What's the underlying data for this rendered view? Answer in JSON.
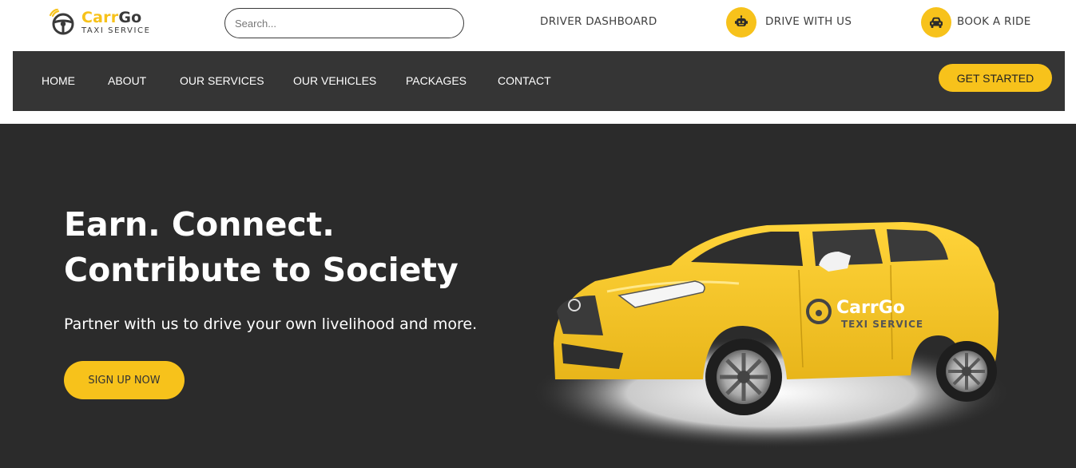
{
  "brand": {
    "name_part1": "Carr",
    "name_part2": "Go",
    "tagline": "TAXI SERVICE",
    "accent_color": "#f7c21b"
  },
  "search": {
    "placeholder": "Search..."
  },
  "top_links": {
    "driver_dashboard": "DRIVER DASHBOARD",
    "drive_with_us": "DRIVE WITH US",
    "drive_with_us_icon": "robot-icon",
    "book_a_ride": "BOOK A RIDE",
    "book_a_ride_icon": "car-icon"
  },
  "nav": {
    "items": [
      {
        "label": "HOME"
      },
      {
        "label": "ABOUT"
      },
      {
        "label": "OUR SERVICES"
      },
      {
        "label": "OUR VEHICLES"
      },
      {
        "label": "PACKAGES"
      },
      {
        "label": "CONTACT"
      }
    ],
    "cta_label": "GET STARTED",
    "background_color": "#353535"
  },
  "hero": {
    "title": "Earn. Connect. Contribute to Society",
    "subtitle": "Partner with us to drive your own livelihood and more.",
    "button_label": "SIGN UP NOW",
    "background_color": "#2b2b2b",
    "car_decal_name": "CarrGo",
    "car_decal_tagline": "TEXI SERVICE"
  }
}
